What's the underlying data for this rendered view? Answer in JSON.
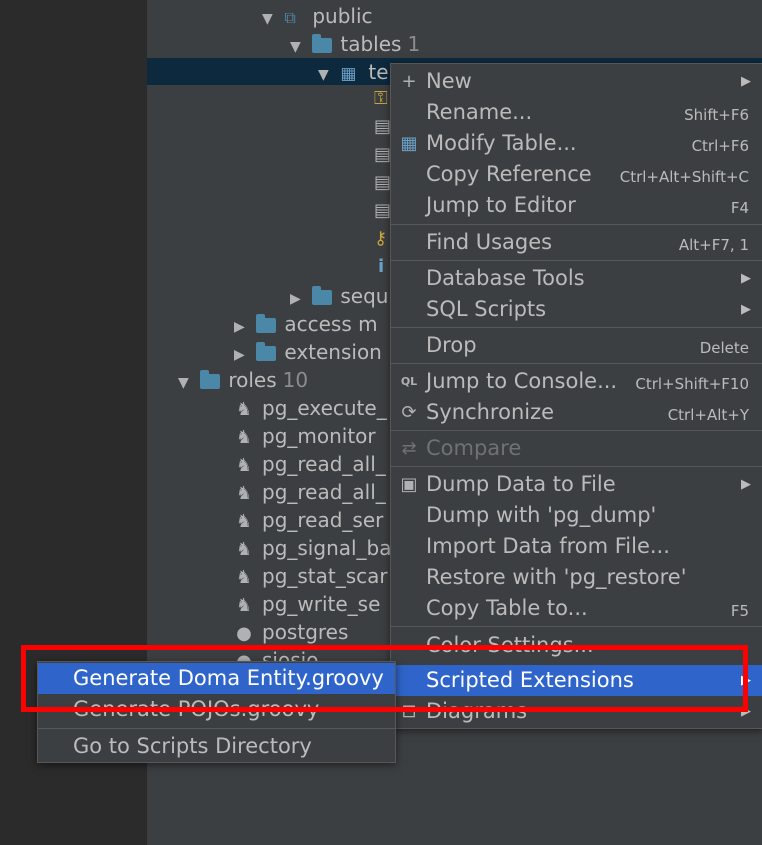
{
  "tree": {
    "public_label": "public",
    "tables_label": "tables",
    "tables_count": "1",
    "table_label": "te",
    "seq_label": "sequ",
    "access_label": "access m",
    "extension_label": "extension",
    "roles_label": "roles",
    "roles_count": "10",
    "roles": [
      "pg_execute_",
      "pg_monitor",
      "pg_read_all_",
      "pg_read_all_",
      "pg_read_ser",
      "pg_signal_ba",
      "pg_stat_scar",
      "pg_write_se",
      "postgres",
      "siosio"
    ]
  },
  "context_menu": {
    "items": [
      {
        "label": "New",
        "shortcut": "",
        "icon": "plus-icon",
        "submenu": true
      },
      {
        "label": "Rename...",
        "shortcut": "Shift+F6",
        "icon": "",
        "submenu": false
      },
      {
        "label": "Modify Table...",
        "shortcut": "Ctrl+F6",
        "icon": "table-icon",
        "submenu": false
      },
      {
        "label": "Copy Reference",
        "shortcut": "Ctrl+Alt+Shift+C",
        "icon": "",
        "submenu": false
      },
      {
        "label": "Jump to Editor",
        "shortcut": "F4",
        "icon": "",
        "submenu": false
      },
      {
        "label": "Find Usages",
        "shortcut": "Alt+F7, 1",
        "icon": "",
        "submenu": false
      },
      {
        "label": "Database Tools",
        "shortcut": "",
        "icon": "",
        "submenu": true
      },
      {
        "label": "SQL Scripts",
        "shortcut": "",
        "icon": "",
        "submenu": true
      },
      {
        "label": "Drop",
        "shortcut": "Delete",
        "icon": "",
        "submenu": false
      },
      {
        "label": "Jump to Console...",
        "shortcut": "Ctrl+Shift+F10",
        "icon": "console-icon",
        "submenu": false
      },
      {
        "label": "Synchronize",
        "shortcut": "Ctrl+Alt+Y",
        "icon": "sync-icon",
        "submenu": false
      },
      {
        "label": "Compare",
        "shortcut": "",
        "icon": "compare-icon",
        "submenu": false,
        "disabled": true
      },
      {
        "label": "Dump Data to File",
        "shortcut": "",
        "icon": "save-icon",
        "submenu": true
      },
      {
        "label": "Dump with 'pg_dump'",
        "shortcut": "",
        "icon": "",
        "submenu": false
      },
      {
        "label": "Import Data from File...",
        "shortcut": "",
        "icon": "",
        "submenu": false
      },
      {
        "label": "Restore with 'pg_restore'",
        "shortcut": "",
        "icon": "",
        "submenu": false
      },
      {
        "label": "Copy Table to...",
        "shortcut": "F5",
        "icon": "",
        "submenu": false
      },
      {
        "label": "Color Settings...",
        "shortcut": "",
        "icon": "",
        "submenu": false
      },
      {
        "label": "Scripted Extensions",
        "shortcut": "",
        "icon": "",
        "submenu": true,
        "highlighted": true
      },
      {
        "label": "Diagrams",
        "shortcut": "",
        "icon": "diagram-icon",
        "submenu": true
      }
    ]
  },
  "submenu": {
    "items": [
      {
        "label": "Generate Doma Entity.groovy",
        "highlighted": true
      },
      {
        "label": "Generate POJOs.groovy",
        "highlighted": false
      },
      {
        "label": "Go to Scripts Directory",
        "highlighted": false
      }
    ]
  },
  "colors": {
    "highlight": "#2f65ca",
    "annotation_box": "#ff0000",
    "background": "#3c3f41"
  }
}
